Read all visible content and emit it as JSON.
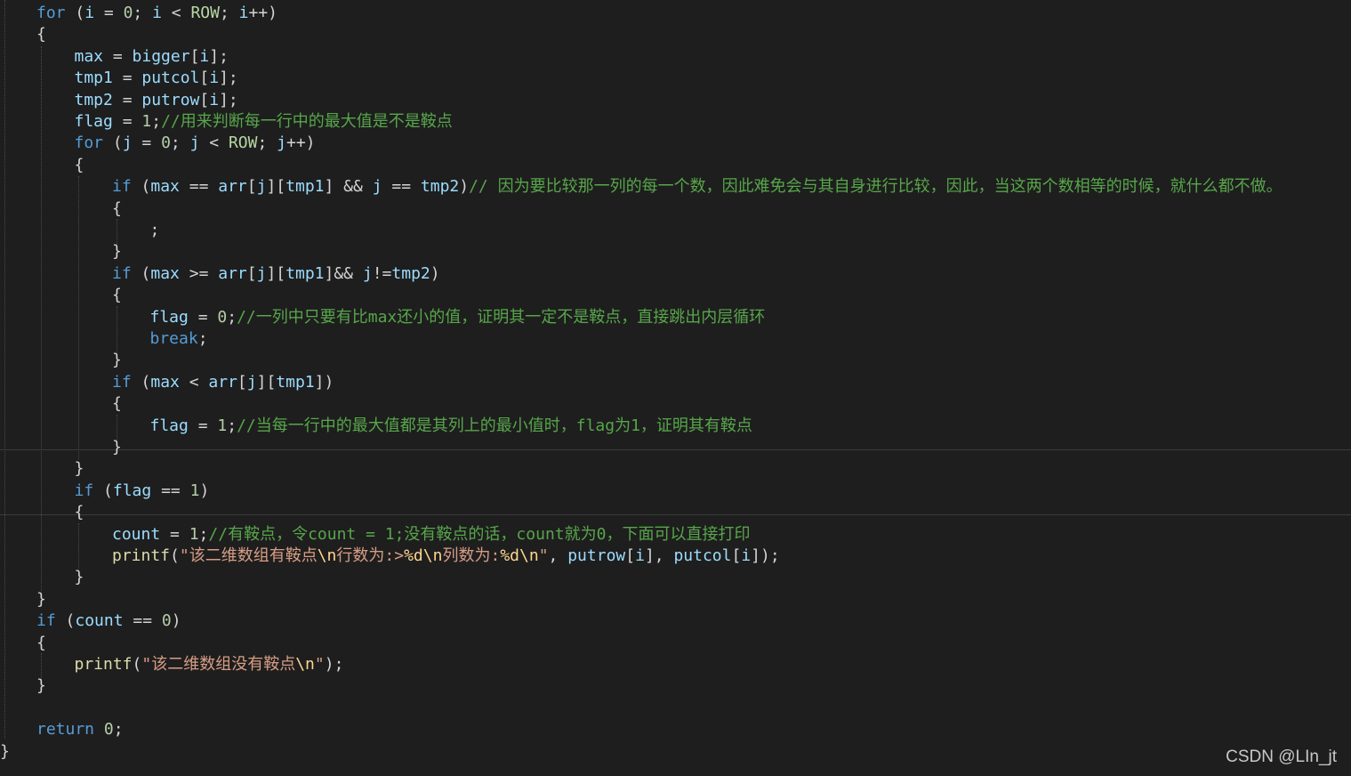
{
  "colors": {
    "background": "#1e1e1e",
    "keyword": "#569cd6",
    "variable": "#9cdcfe",
    "function": "#dcdcaa",
    "number": "#b5cea8",
    "string": "#d69d85",
    "comment": "#57a64a",
    "default": "#dcdcdc"
  },
  "code_lines": [
    {
      "indent": 1,
      "tokens": [
        [
          "for",
          "kw"
        ],
        [
          " (",
          "op"
        ],
        [
          "i",
          "var"
        ],
        [
          " = ",
          "op"
        ],
        [
          "0",
          "num"
        ],
        [
          "; ",
          "op"
        ],
        [
          "i",
          "var"
        ],
        [
          " < ",
          "op"
        ],
        [
          "ROW",
          "macro"
        ],
        [
          "; ",
          "op"
        ],
        [
          "i",
          "var"
        ],
        [
          "++)",
          "op"
        ]
      ]
    },
    {
      "indent": 1,
      "tokens": [
        [
          "{",
          "op"
        ]
      ]
    },
    {
      "indent": 2,
      "tokens": [
        [
          "max",
          "var"
        ],
        [
          " = ",
          "op"
        ],
        [
          "bigger",
          "var"
        ],
        [
          "[",
          "op"
        ],
        [
          "i",
          "var"
        ],
        [
          "];",
          "op"
        ]
      ]
    },
    {
      "indent": 2,
      "tokens": [
        [
          "tmp1",
          "var"
        ],
        [
          " = ",
          "op"
        ],
        [
          "putcol",
          "var"
        ],
        [
          "[",
          "op"
        ],
        [
          "i",
          "var"
        ],
        [
          "];",
          "op"
        ]
      ]
    },
    {
      "indent": 2,
      "tokens": [
        [
          "tmp2",
          "var"
        ],
        [
          " = ",
          "op"
        ],
        [
          "putrow",
          "var"
        ],
        [
          "[",
          "op"
        ],
        [
          "i",
          "var"
        ],
        [
          "];",
          "op"
        ]
      ]
    },
    {
      "indent": 2,
      "tokens": [
        [
          "flag",
          "var"
        ],
        [
          " = ",
          "op"
        ],
        [
          "1",
          "num"
        ],
        [
          ";",
          "op"
        ],
        [
          "//用来判断每一行中的最大值是不是鞍点",
          "cm"
        ]
      ]
    },
    {
      "indent": 2,
      "tokens": [
        [
          "for",
          "kw"
        ],
        [
          " (",
          "op"
        ],
        [
          "j",
          "var"
        ],
        [
          " = ",
          "op"
        ],
        [
          "0",
          "num"
        ],
        [
          "; ",
          "op"
        ],
        [
          "j",
          "var"
        ],
        [
          " < ",
          "op"
        ],
        [
          "ROW",
          "macro"
        ],
        [
          "; ",
          "op"
        ],
        [
          "j",
          "var"
        ],
        [
          "++)",
          "op"
        ]
      ]
    },
    {
      "indent": 2,
      "tokens": [
        [
          "{",
          "op"
        ]
      ]
    },
    {
      "indent": 3,
      "tokens": [
        [
          "if",
          "kw"
        ],
        [
          " (",
          "op"
        ],
        [
          "max",
          "var"
        ],
        [
          " == ",
          "op"
        ],
        [
          "arr",
          "var"
        ],
        [
          "[",
          "op"
        ],
        [
          "j",
          "var"
        ],
        [
          "][",
          "op"
        ],
        [
          "tmp1",
          "var"
        ],
        [
          "] && ",
          "op"
        ],
        [
          "j",
          "var"
        ],
        [
          " == ",
          "op"
        ],
        [
          "tmp2",
          "var"
        ],
        [
          ")",
          "op"
        ],
        [
          "// 因为要比较那一列的每一个数，因此难免会与其自身进行比较，因此，当这两个数相等的时候，就什么都不做。",
          "cm"
        ]
      ]
    },
    {
      "indent": 3,
      "tokens": [
        [
          "{",
          "op"
        ]
      ]
    },
    {
      "indent": 4,
      "tokens": [
        [
          ";",
          "op"
        ]
      ]
    },
    {
      "indent": 3,
      "tokens": [
        [
          "}",
          "op"
        ]
      ]
    },
    {
      "indent": 3,
      "tokens": [
        [
          "if",
          "kw"
        ],
        [
          " (",
          "op"
        ],
        [
          "max",
          "var"
        ],
        [
          " >= ",
          "op"
        ],
        [
          "arr",
          "var"
        ],
        [
          "[",
          "op"
        ],
        [
          "j",
          "var"
        ],
        [
          "][",
          "op"
        ],
        [
          "tmp1",
          "var"
        ],
        [
          "]&& ",
          "op"
        ],
        [
          "j",
          "var"
        ],
        [
          "!=",
          "op"
        ],
        [
          "tmp2",
          "var"
        ],
        [
          ")",
          "op"
        ]
      ]
    },
    {
      "indent": 3,
      "tokens": [
        [
          "{",
          "op"
        ]
      ]
    },
    {
      "indent": 4,
      "tokens": [
        [
          "flag",
          "var"
        ],
        [
          " = ",
          "op"
        ],
        [
          "0",
          "num"
        ],
        [
          ";",
          "op"
        ],
        [
          "//一列中只要有比max还小的值，证明其一定不是鞍点，直接跳出内层循环",
          "cm"
        ]
      ]
    },
    {
      "indent": 4,
      "tokens": [
        [
          "break",
          "kw"
        ],
        [
          ";",
          "op"
        ]
      ]
    },
    {
      "indent": 3,
      "tokens": [
        [
          "}",
          "op"
        ]
      ]
    },
    {
      "indent": 3,
      "tokens": [
        [
          "if",
          "kw"
        ],
        [
          " (",
          "op"
        ],
        [
          "max",
          "var"
        ],
        [
          " < ",
          "op"
        ],
        [
          "arr",
          "var"
        ],
        [
          "[",
          "op"
        ],
        [
          "j",
          "var"
        ],
        [
          "][",
          "op"
        ],
        [
          "tmp1",
          "var"
        ],
        [
          "])",
          "op"
        ]
      ]
    },
    {
      "indent": 3,
      "tokens": [
        [
          "{",
          "op"
        ]
      ]
    },
    {
      "indent": 4,
      "tokens": [
        [
          "flag",
          "var"
        ],
        [
          " = ",
          "op"
        ],
        [
          "1",
          "num"
        ],
        [
          ";",
          "op"
        ],
        [
          "//当每一行中的最大值都是其列上的最小值时，flag为1，证明其有鞍点",
          "cm"
        ]
      ]
    },
    {
      "indent": 3,
      "tokens": [
        [
          "}",
          "op"
        ]
      ]
    },
    {
      "indent": 2,
      "tokens": [
        [
          "}",
          "op"
        ]
      ]
    },
    {
      "indent": 2,
      "tokens": [
        [
          "if",
          "kw"
        ],
        [
          " (",
          "op"
        ],
        [
          "flag",
          "var"
        ],
        [
          " == ",
          "op"
        ],
        [
          "1",
          "num"
        ],
        [
          ")",
          "op"
        ]
      ]
    },
    {
      "indent": 2,
      "tokens": [
        [
          "{",
          "op"
        ]
      ]
    },
    {
      "indent": 3,
      "tokens": [
        [
          "count",
          "var"
        ],
        [
          " = ",
          "op"
        ],
        [
          "1",
          "num"
        ],
        [
          ";",
          "op"
        ],
        [
          "//有鞍点，令count = 1;没有鞍点的话，count就为0，下面可以直接打印",
          "cm"
        ]
      ]
    },
    {
      "indent": 3,
      "tokens": [
        [
          "printf",
          "fn"
        ],
        [
          "(",
          "op"
        ],
        [
          "\"该二维数组有鞍点",
          "str"
        ],
        [
          "\\n",
          "esc"
        ],
        [
          "行数为:>",
          "str"
        ],
        [
          "%d",
          "esc"
        ],
        [
          "\\n",
          "esc"
        ],
        [
          "列数为:",
          "str"
        ],
        [
          "%d",
          "esc"
        ],
        [
          "\\n",
          "esc"
        ],
        [
          "\"",
          "str"
        ],
        [
          ", ",
          "op"
        ],
        [
          "putrow",
          "var"
        ],
        [
          "[",
          "op"
        ],
        [
          "i",
          "var"
        ],
        [
          "], ",
          "op"
        ],
        [
          "putcol",
          "var"
        ],
        [
          "[",
          "op"
        ],
        [
          "i",
          "var"
        ],
        [
          "]);",
          "op"
        ]
      ]
    },
    {
      "indent": 2,
      "tokens": [
        [
          "}",
          "op"
        ]
      ]
    },
    {
      "indent": 1,
      "tokens": [
        [
          "}",
          "op"
        ]
      ]
    },
    {
      "indent": 1,
      "tokens": [
        [
          "if",
          "kw"
        ],
        [
          " (",
          "op"
        ],
        [
          "count",
          "var"
        ],
        [
          " == ",
          "op"
        ],
        [
          "0",
          "num"
        ],
        [
          ")",
          "op"
        ]
      ]
    },
    {
      "indent": 1,
      "tokens": [
        [
          "{",
          "op"
        ]
      ]
    },
    {
      "indent": 2,
      "tokens": [
        [
          "printf",
          "fn"
        ],
        [
          "(",
          "op"
        ],
        [
          "\"该二维数组没有鞍点",
          "str"
        ],
        [
          "\\n",
          "esc"
        ],
        [
          "\"",
          "str"
        ],
        [
          ");",
          "op"
        ]
      ]
    },
    {
      "indent": 1,
      "tokens": [
        [
          "}",
          "op"
        ]
      ]
    },
    {
      "indent": 1,
      "tokens": []
    },
    {
      "indent": 1,
      "tokens": [
        [
          "return",
          "kw"
        ],
        [
          " ",
          "op"
        ],
        [
          "0",
          "num"
        ],
        [
          ";",
          "op"
        ]
      ]
    },
    {
      "indent": 0,
      "tokens": [
        [
          "}",
          "op"
        ]
      ]
    }
  ],
  "watermark": "CSDN @LIn_jt"
}
